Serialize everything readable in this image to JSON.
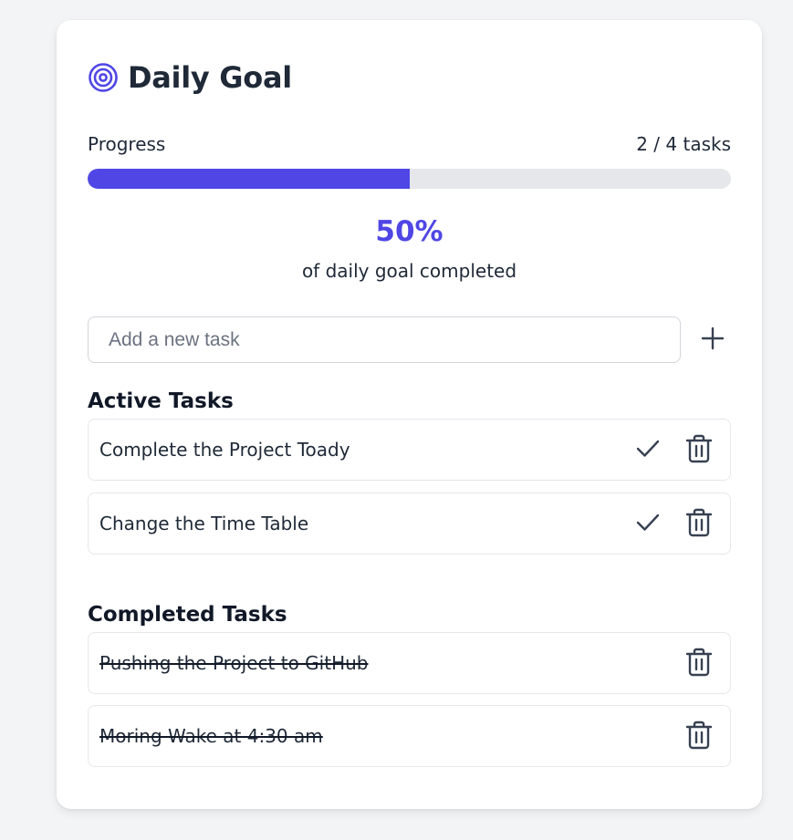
{
  "header": {
    "title": "Daily Goal",
    "icon": "target-icon",
    "accent_color": "#4f46e5"
  },
  "progress": {
    "label": "Progress",
    "count_text": "2 / 4 tasks",
    "completed": 2,
    "total": 4,
    "fraction": 0.5,
    "percent_text": "50%",
    "subtitle": "of daily goal completed"
  },
  "add_task": {
    "placeholder": "Add a new task",
    "value": "",
    "button_icon": "plus-icon"
  },
  "active_section": {
    "title": "Active Tasks",
    "tasks": [
      {
        "text": "Complete the Project Toady"
      },
      {
        "text": "Change the Time Table"
      }
    ]
  },
  "completed_section": {
    "title": "Completed Tasks",
    "tasks": [
      {
        "text": "Pushing the Project to GitHub"
      },
      {
        "text": "Moring Wake at 4:30 am"
      }
    ]
  }
}
